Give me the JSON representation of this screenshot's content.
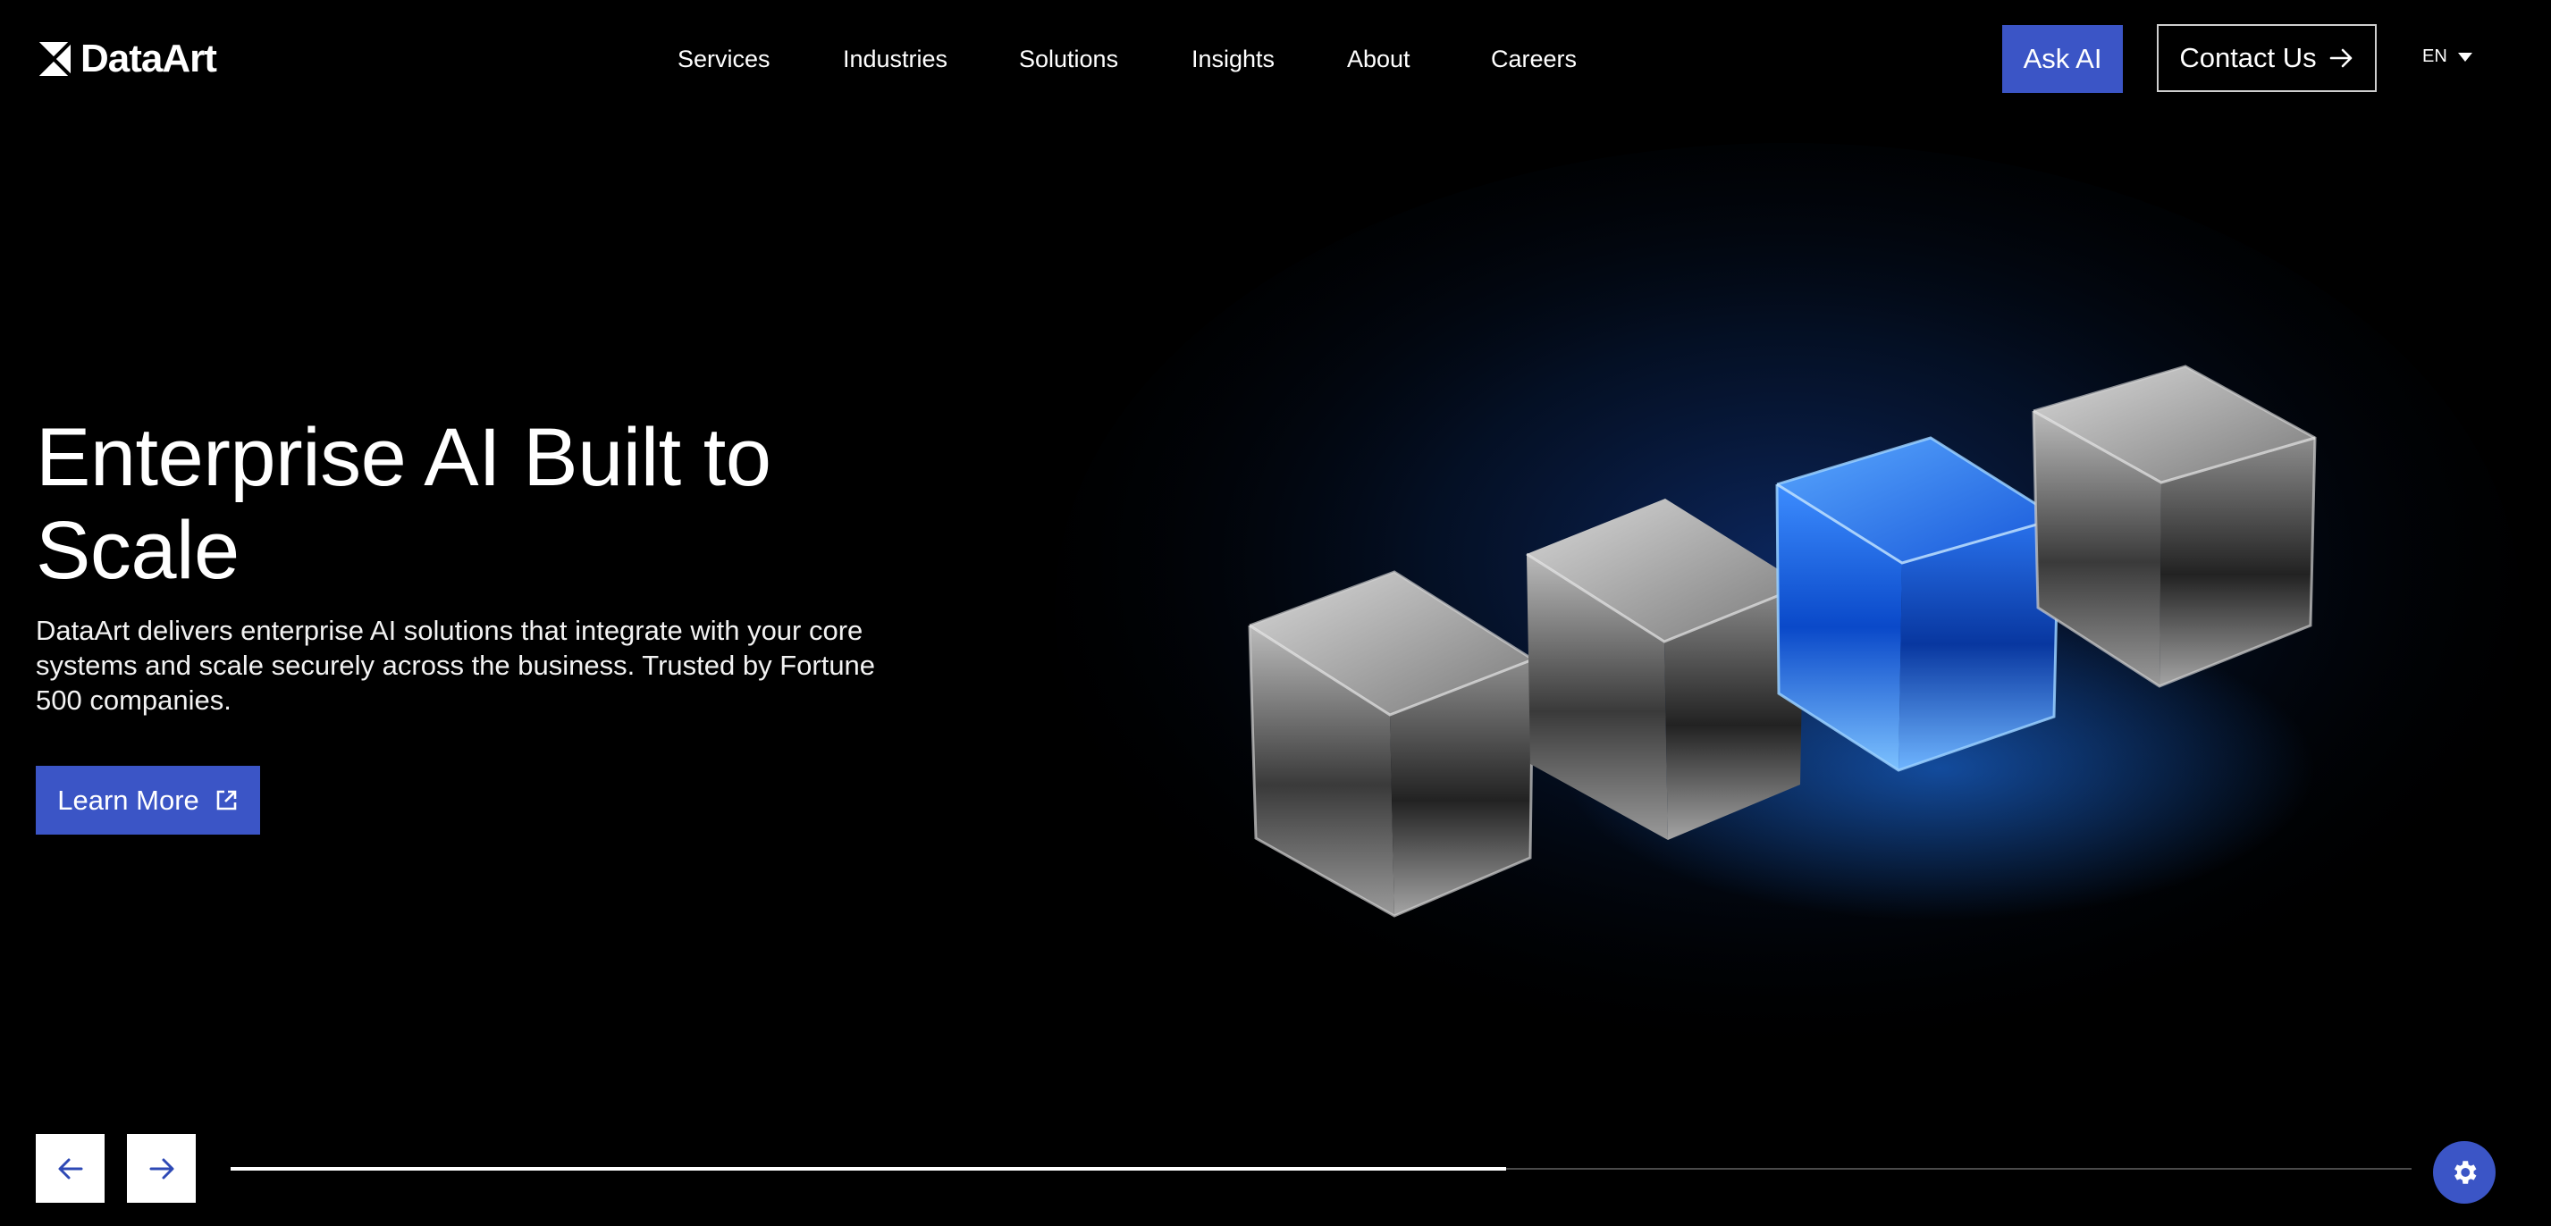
{
  "brand": {
    "name": "DataArt"
  },
  "nav": {
    "items": [
      {
        "label": "Services"
      },
      {
        "label": "Industries"
      },
      {
        "label": "Solutions"
      },
      {
        "label": "Insights"
      },
      {
        "label": "About"
      },
      {
        "label": "Careers"
      }
    ]
  },
  "header_actions": {
    "ask_ai_label": "Ask AI",
    "contact_label": "Contact Us",
    "contact_icon": "arrow-right-icon",
    "language": "EN"
  },
  "hero": {
    "title": "Enterprise AI Built to Scale",
    "description": "DataArt delivers enterprise AI solutions that integrate with your core systems and scale securely across the business. Trusted by Fortune 500 companies.",
    "cta_label": "Learn More",
    "cta_icon": "external-link-icon"
  },
  "slider": {
    "prev_icon": "arrow-left-icon",
    "next_icon": "arrow-right-icon",
    "progress": 0.585
  },
  "fab": {
    "icon": "gear-icon"
  },
  "colors": {
    "background": "#000000",
    "accent": "#3b55c6",
    "text": "#ffffff",
    "cube_glow": "#1f7cff"
  }
}
